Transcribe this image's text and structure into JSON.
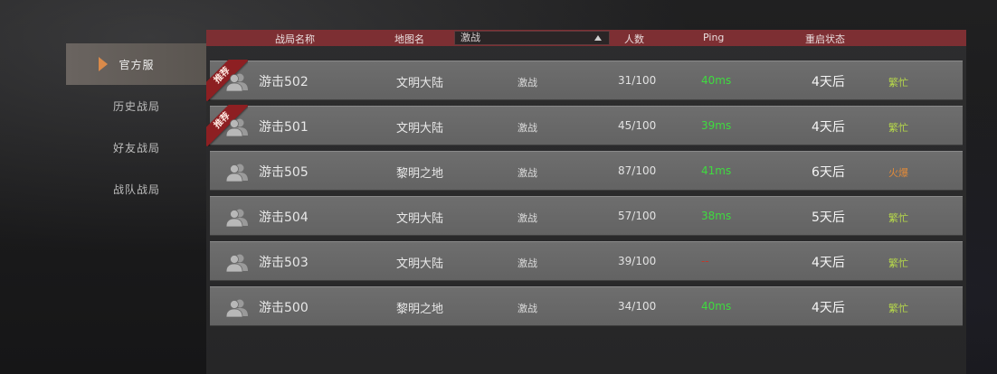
{
  "sidebar": {
    "items": [
      {
        "label": "官方服",
        "active": true
      },
      {
        "label": "历史战局",
        "active": false
      },
      {
        "label": "好友战局",
        "active": false
      },
      {
        "label": "战队战局",
        "active": false
      }
    ]
  },
  "header": {
    "col_name": "战局名称",
    "col_map": "地图名",
    "filter_value": "激战",
    "col_players": "人数",
    "col_ping": "Ping",
    "col_restart": "重启状态"
  },
  "colors": {
    "header_bg": "#7d2f33",
    "ping_green": "#3fdc3f",
    "ping_bad": "#c0392b",
    "status_idle": "#b6d84a",
    "status_hot": "#e08a3a",
    "ribbon": "#8d1f22"
  },
  "rows": [
    {
      "recommended": true,
      "badge": "推荐",
      "name": "游击502",
      "map": "文明大陆",
      "mode": "激战",
      "players": "31/100",
      "ping": "40ms",
      "ping_state": "good",
      "restart": "4天后",
      "status": "繁忙",
      "status_state": "idle"
    },
    {
      "recommended": true,
      "badge": "推荐",
      "name": "游击501",
      "map": "文明大陆",
      "mode": "激战",
      "players": "45/100",
      "ping": "39ms",
      "ping_state": "good",
      "restart": "4天后",
      "status": "繁忙",
      "status_state": "idle"
    },
    {
      "recommended": false,
      "badge": "",
      "name": "游击505",
      "map": "黎明之地",
      "mode": "激战",
      "players": "87/100",
      "ping": "41ms",
      "ping_state": "good",
      "restart": "6天后",
      "status": "火爆",
      "status_state": "hot"
    },
    {
      "recommended": false,
      "badge": "",
      "name": "游击504",
      "map": "文明大陆",
      "mode": "激战",
      "players": "57/100",
      "ping": "38ms",
      "ping_state": "good",
      "restart": "5天后",
      "status": "繁忙",
      "status_state": "idle"
    },
    {
      "recommended": false,
      "badge": "",
      "name": "游击503",
      "map": "文明大陆",
      "mode": "激战",
      "players": "39/100",
      "ping": "--",
      "ping_state": "bad",
      "restart": "4天后",
      "status": "繁忙",
      "status_state": "idle"
    },
    {
      "recommended": false,
      "badge": "",
      "name": "游击500",
      "map": "黎明之地",
      "mode": "激战",
      "players": "34/100",
      "ping": "40ms",
      "ping_state": "good",
      "restart": "4天后",
      "status": "繁忙",
      "status_state": "idle"
    }
  ]
}
